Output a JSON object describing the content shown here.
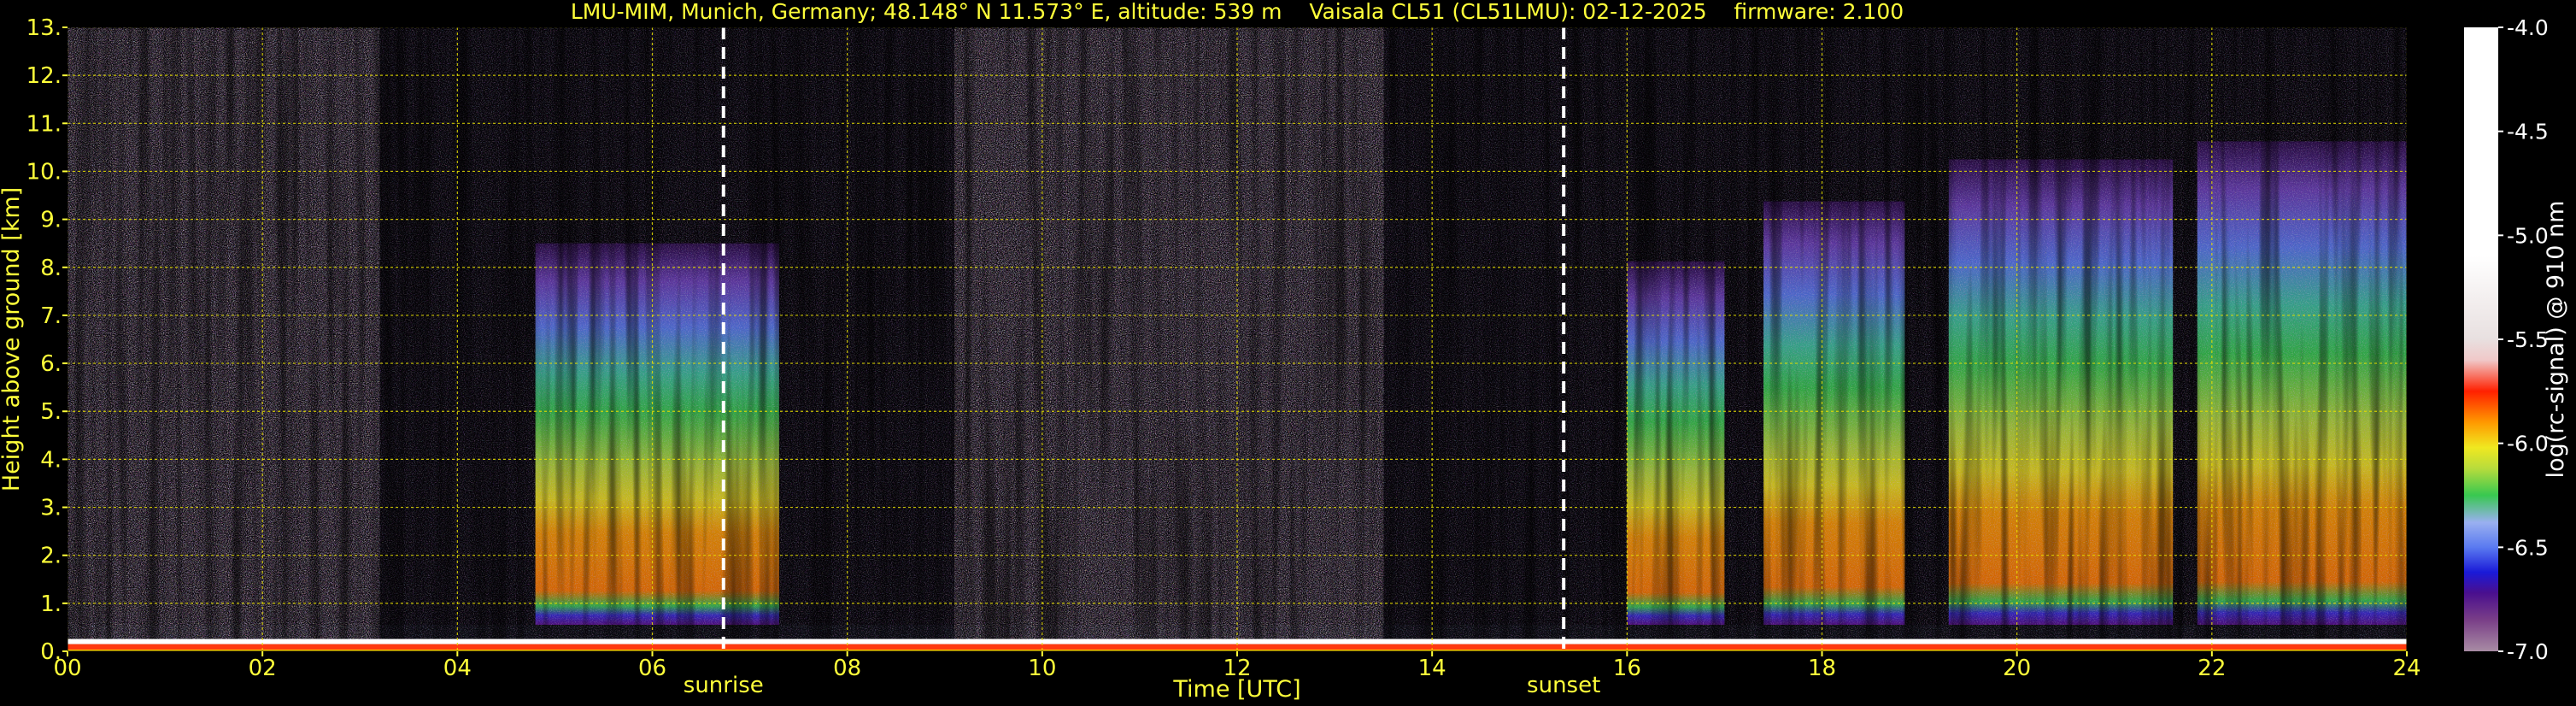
{
  "chart_data": {
    "type": "heatmap",
    "title": "LMU-MIM, Munich, Germany; 48.148° N 11.573° E, altitude: 539 m    Vaisala CL51 (CL51LMU): 02-12-2025    firmware: 2.100",
    "xlabel": "Time [UTC]",
    "ylabel": "Height above ground [km]",
    "colorbar_label": "log(rc-signal) @ 910 nm",
    "xlim": [
      0,
      24
    ],
    "ylim": [
      0,
      13
    ],
    "x_ticks": [
      {
        "value": 0,
        "label": "00"
      },
      {
        "value": 2,
        "label": "02"
      },
      {
        "value": 4,
        "label": "04"
      },
      {
        "value": 6,
        "label": "06"
      },
      {
        "value": 8,
        "label": "08"
      },
      {
        "value": 10,
        "label": "10"
      },
      {
        "value": 12,
        "label": "12"
      },
      {
        "value": 14,
        "label": "14"
      },
      {
        "value": 16,
        "label": "16"
      },
      {
        "value": 18,
        "label": "18"
      },
      {
        "value": 20,
        "label": "20"
      },
      {
        "value": 22,
        "label": "22"
      },
      {
        "value": 24,
        "label": "24"
      }
    ],
    "y_ticks": [
      {
        "value": 0,
        "label": "0."
      },
      {
        "value": 1,
        "label": "1."
      },
      {
        "value": 2,
        "label": "2."
      },
      {
        "value": 3,
        "label": "3."
      },
      {
        "value": 4,
        "label": "4."
      },
      {
        "value": 5,
        "label": "5."
      },
      {
        "value": 6,
        "label": "6."
      },
      {
        "value": 7,
        "label": "7."
      },
      {
        "value": 8,
        "label": "8."
      },
      {
        "value": 9,
        "label": "9."
      },
      {
        "value": 10,
        "label": "10."
      },
      {
        "value": 11,
        "label": "11."
      },
      {
        "value": 12,
        "label": "12."
      },
      {
        "value": 13,
        "label": "13."
      }
    ],
    "colorbar": {
      "range": [
        -7.0,
        -4.0
      ],
      "ticks": [
        {
          "value": -4.0,
          "label": "-4.0"
        },
        {
          "value": -4.5,
          "label": "-4.5"
        },
        {
          "value": -5.0,
          "label": "-5.0"
        },
        {
          "value": -5.5,
          "label": "-5.5"
        },
        {
          "value": -6.0,
          "label": "-6.0"
        },
        {
          "value": -6.5,
          "label": "-6.5"
        },
        {
          "value": -7.0,
          "label": "-7.0"
        }
      ],
      "stops": [
        {
          "value": -7.0,
          "color": "#a88ca4"
        },
        {
          "value": -6.85,
          "color": "#7a3f88"
        },
        {
          "value": -6.72,
          "color": "#4a0f8e"
        },
        {
          "value": -6.62,
          "color": "#1a1ad8"
        },
        {
          "value": -6.5,
          "color": "#5a7af0"
        },
        {
          "value": -6.38,
          "color": "#9ab0f0"
        },
        {
          "value": -6.25,
          "color": "#38c850"
        },
        {
          "value": -6.12,
          "color": "#b8dc3c"
        },
        {
          "value": -6.02,
          "color": "#f0e820"
        },
        {
          "value": -5.9,
          "color": "#ff9a00"
        },
        {
          "value": -5.75,
          "color": "#ff2000"
        },
        {
          "value": -5.6,
          "color": "#f0c8c8"
        },
        {
          "value": -5.5,
          "color": "#e8e0e0"
        },
        {
          "value": -5.1,
          "color": "#ffffff"
        },
        {
          "value": -4.0,
          "color": "#ffffff"
        }
      ]
    },
    "grid": true,
    "event_lines": [
      {
        "label": "sunrise",
        "time": 6.73
      },
      {
        "label": "sunset",
        "time": 15.35
      }
    ],
    "aerosol_layers": [
      {
        "start": 4.8,
        "end": 7.3,
        "top_km": 6.8,
        "core_top_km": 2.8
      },
      {
        "start": 16.0,
        "end": 17.0,
        "top_km": 6.5,
        "core_top_km": 3.5
      },
      {
        "start": 17.4,
        "end": 18.85,
        "top_km": 7.5,
        "core_top_km": 2.6
      },
      {
        "start": 19.3,
        "end": 21.6,
        "top_km": 8.2,
        "core_top_km": 2.5
      },
      {
        "start": 21.85,
        "end": 24.0,
        "top_km": 8.5,
        "core_top_km": 2.3
      }
    ],
    "high_noise_periods": [
      {
        "start": 0.0,
        "end": 3.2
      },
      {
        "start": 9.1,
        "end": 13.5
      }
    ],
    "surface_layer": {
      "top_km": 0.15
    }
  }
}
